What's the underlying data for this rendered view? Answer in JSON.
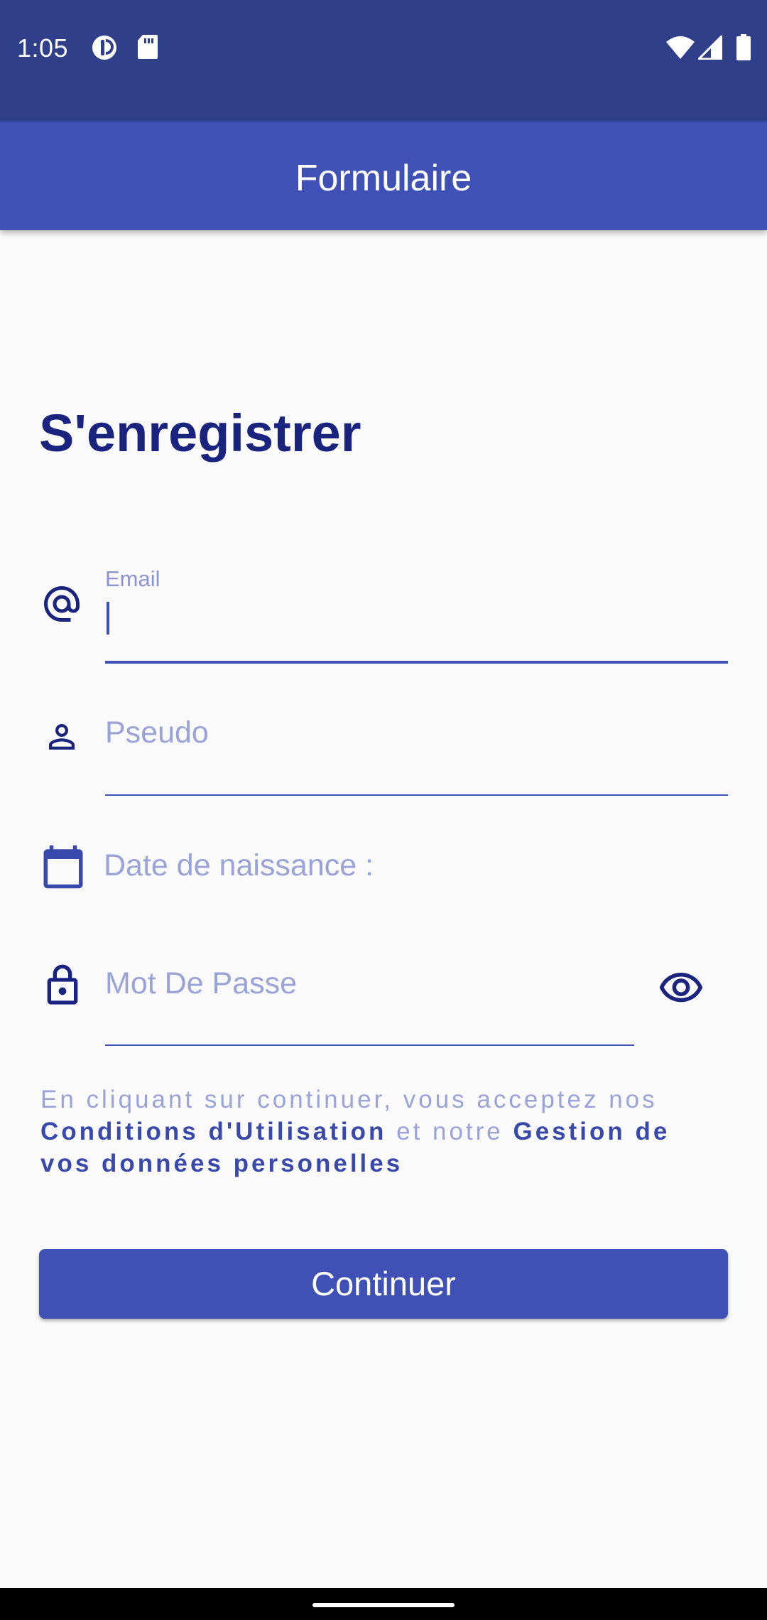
{
  "status_bar": {
    "time": "1:05",
    "left_icons": [
      "data-saver-icon",
      "sd-card-icon"
    ],
    "right_icons": [
      "wifi-icon",
      "cell-signal-icon",
      "battery-icon"
    ]
  },
  "app_bar": {
    "title": "Formulaire"
  },
  "form": {
    "heading": "S'enregistrer",
    "email": {
      "icon": "at-sign-icon",
      "label": "Email",
      "value": ""
    },
    "pseudo": {
      "icon": "person-icon",
      "placeholder": "Pseudo"
    },
    "birthdate": {
      "icon": "calendar-icon",
      "placeholder": "Date de naissance :"
    },
    "password": {
      "icon": "lock-icon",
      "placeholder": "Mot De Passe",
      "toggle_icon": "eye-icon"
    },
    "terms": {
      "prefix": "En cliquant sur continuer, vous acceptez nos ",
      "conditions_link": "Conditions d'Utilisation",
      "middle": " et notre ",
      "privacy_link": "Gestion de vos données personelles"
    },
    "submit_label": "Continuer"
  },
  "colors": {
    "status_bar": "#303f8a",
    "primary": "#3f51b5",
    "heading": "#1a237e",
    "hint": "#9aa3d8",
    "background": "#fafafa"
  }
}
